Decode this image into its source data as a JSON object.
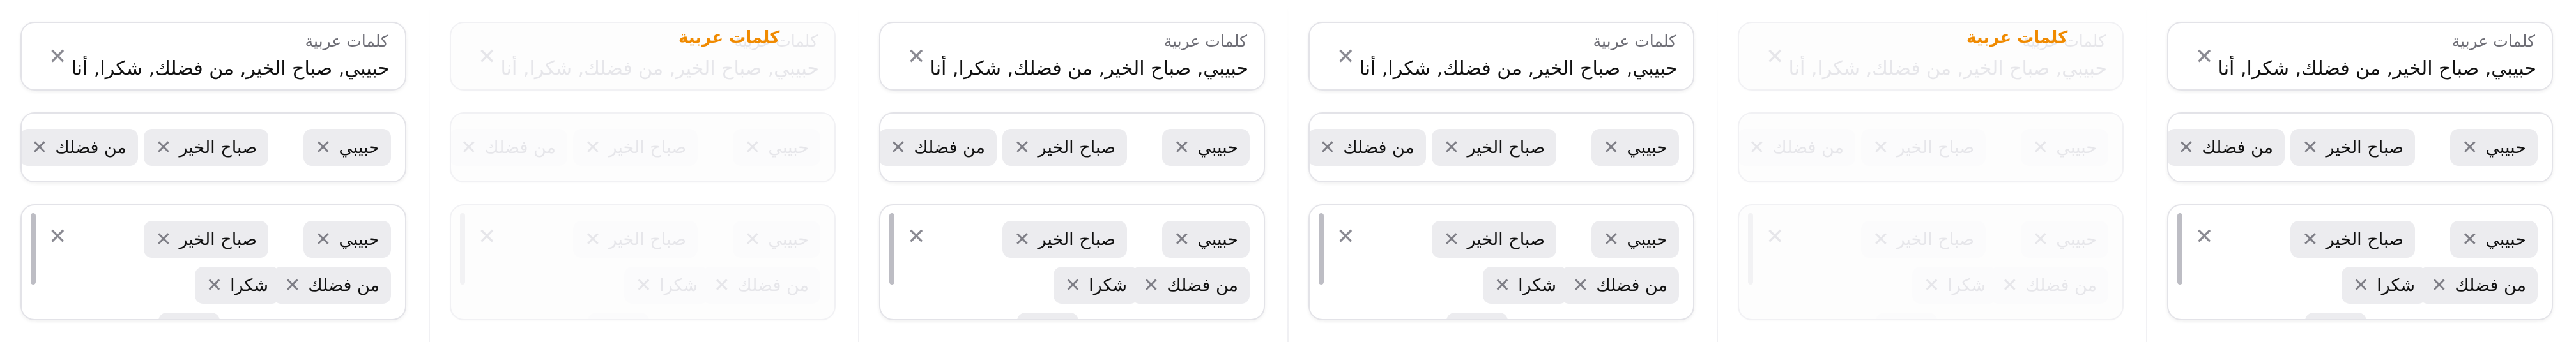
{
  "field": {
    "label": "كلمات عربية",
    "value": "حبيبي, صباح الخير, من فضلك, شكرا, أنا"
  },
  "chips": [
    "حبيبي",
    "صباح الخير",
    "من فضلك",
    "شكرا",
    "أنا"
  ],
  "title_overlay": "كلمات عربية",
  "icons": {
    "clear": "close-icon",
    "chip_remove": "close-icon"
  },
  "colors": {
    "title_overlay": "#f08a00",
    "chip_bg": "#ececef",
    "card_border": "#e3e3e8",
    "label": "#6e6e76",
    "text": "#111111"
  },
  "panels": [
    {
      "state": "normal"
    },
    {
      "state": "faded",
      "title_visible": true
    },
    {
      "state": "normal"
    },
    {
      "state": "normal"
    },
    {
      "state": "faded",
      "title_visible": true
    },
    {
      "state": "normal"
    }
  ]
}
